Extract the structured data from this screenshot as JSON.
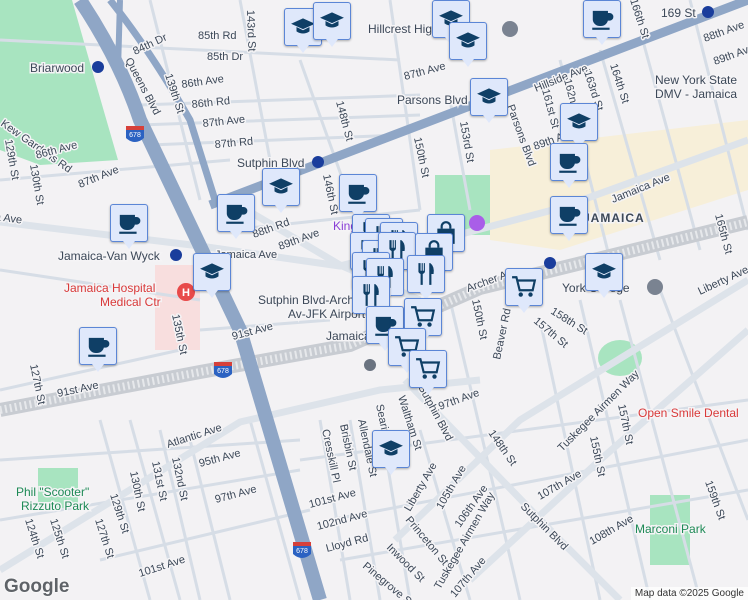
{
  "map": {
    "places": {
      "briarwood": "Briarwood",
      "hillcrest": "Hillcrest High School",
      "sutphin_station": "Sutphin Blvd",
      "parsons_station": "Parsons Blvd",
      "st169": "169 St",
      "dmv1": "New York State",
      "dmv2": "DMV - Jamaica",
      "jvw": "Jamaica-Van Wyck",
      "hospital1": "Jamaica Hospital",
      "hospital2": "Medical Ctr",
      "sutphin_archer1": "Sutphin Blvd-Archer",
      "sutphin_archer2": "Av-JFK Airport",
      "jamaica_station": "Jamaica",
      "jamaica_area": "JAMAICA",
      "york": "York College",
      "rizzuto1": "Phil \"Scooter\"",
      "rizzuto2": "Rizzuto Park",
      "marconi": "Marconi Park",
      "dental": "Open Smile Dental",
      "kings": "King"
    },
    "streets": {
      "s84dr": "84th Dr",
      "s85rd": "85th Rd",
      "s85dr": "85th Dr",
      "s86ave": "86th Ave",
      "s86rd": "86th Rd",
      "s87ave": "87th Ave",
      "s87rd": "87th Rd",
      "s87avew": "87th Ave",
      "s88rd": "88th Rd",
      "s89ave": "89th Ave",
      "s139": "139th St",
      "s143": "143rd St",
      "s146": "146th St",
      "s148": "148th St",
      "queens": "Queens Blvd",
      "s129": "129th St",
      "s130": "130th St",
      "kens": "Kew Gardens Rd",
      "jamaica_w": "Jamaica Ave",
      "jamaica_e": "Jamaica Ave",
      "s86avee": "86th Ave",
      "s87avee": "87th Ave",
      "hillside": "Hillside Ave.",
      "s150": "150th St",
      "s153": "153rd St",
      "parsons": "Parsons Blvd",
      "s161": "161st St",
      "s162": "162nd St",
      "s163": "163rd St",
      "s164": "164th St",
      "s165": "165th St",
      "s166": "166th St",
      "s88avee": "88th Ave",
      "s89avee": "89th Ave",
      "s89ave2": "89th Ave",
      "archer": "Archer Ave",
      "liberty_e": "Liberty Ave",
      "s135": "135th St",
      "s91ave": "91st Ave",
      "s91avew": "91st Ave",
      "s127": "127th St",
      "atlantic": "Atlantic Ave",
      "s95": "95th Ave",
      "s97": "97th Ave",
      "s130s": "130th St",
      "s131": "131st St",
      "s132": "132nd St",
      "s129s": "129th St",
      "s127s": "127th St",
      "s125": "125th St",
      "s124": "124th St",
      "s101": "101st Ave",
      "s101w": "101st Ave",
      "s102": "102nd Ave",
      "lloyd": "Lloyd Rd",
      "cresskill": "Cresskill Pl",
      "brisbin": "Brisbin St",
      "allen": "Allendale St",
      "sear": "Searing Ave",
      "waltham": "Waltham St",
      "sutphin_s": "Sutphin Blvd",
      "sutphin_s2": "Sutphin Blvd",
      "s97e": "97th Ave",
      "s150s": "150th St",
      "beaver": "Beaver Rd",
      "s157": "157th St",
      "s158": "158th St",
      "tuskegee": "Tuskegee Airmen Way",
      "tuskegee2": "Tuskegee Airmen Way",
      "s157b": "157th St",
      "s155": "155th St",
      "s148s": "148th St",
      "liberty": "Liberty Ave",
      "s105": "105th Ave",
      "s106": "106th Ave",
      "s107": "107th Ave",
      "s107b": "107th Ave",
      "s108": "108th Ave",
      "s159": "159th St",
      "princeton": "Princeton St",
      "inwood": "Inwood St",
      "pinegrove": "Pinegrove St",
      "i678": "678"
    },
    "attribution": "Map data ©2025 Google",
    "logo": "Google"
  },
  "colors": {
    "highway": "#8fa6c6",
    "park": "#a8e4c0",
    "marker_bg": "#dfe8fb",
    "marker_icon": "#0f3f66"
  }
}
